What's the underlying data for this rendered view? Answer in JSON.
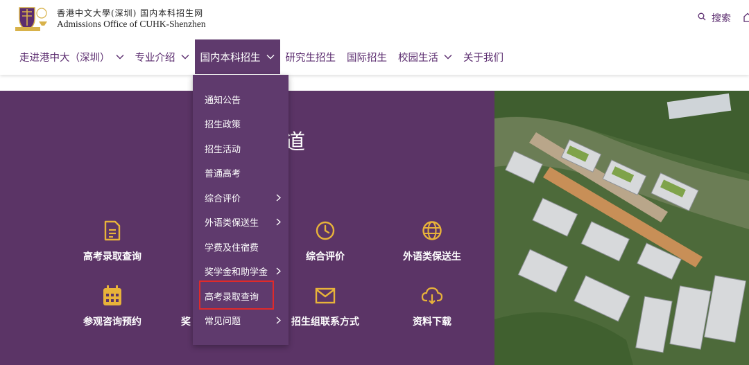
{
  "header": {
    "logo_cn": "香港中文大學(深圳) 国内本科招生网",
    "logo_en": "Admissions Office of CUHK-Shenzhen",
    "search_label": "搜索",
    "search_icon": "search-icon",
    "home_icon": "home-icon"
  },
  "nav": {
    "items": [
      {
        "label": "走进港中大（深圳）",
        "has_dropdown": true
      },
      {
        "label": "专业介绍",
        "has_dropdown": true
      },
      {
        "label": "国内本科招生",
        "has_dropdown": true,
        "active": true
      },
      {
        "label": "研究生招生",
        "has_dropdown": false
      },
      {
        "label": "国际招生",
        "has_dropdown": false
      },
      {
        "label": "校园生活",
        "has_dropdown": true
      },
      {
        "label": "关于我们",
        "has_dropdown": false
      }
    ]
  },
  "dropdown": {
    "items": [
      {
        "label": "通知公告",
        "has_submenu": false
      },
      {
        "label": "招生政策",
        "has_submenu": false
      },
      {
        "label": "招生活动",
        "has_submenu": false
      },
      {
        "label": "普通高考",
        "has_submenu": false
      },
      {
        "label": "综合评价",
        "has_submenu": true
      },
      {
        "label": "外语类保送生",
        "has_submenu": true
      },
      {
        "label": "学费及住宿费",
        "has_submenu": false
      },
      {
        "label": "奖学金和助学金",
        "has_submenu": true
      },
      {
        "label": "高考录取查询",
        "has_submenu": false,
        "highlighted": true
      },
      {
        "label": "常见问题",
        "has_submenu": true
      }
    ]
  },
  "hero": {
    "title_visible": "道",
    "quick_links": [
      {
        "label": "高考录取查询",
        "icon": "document-icon"
      },
      {
        "label": "综合评价",
        "icon": "clock-icon"
      },
      {
        "label": "外语类保送生",
        "icon": "globe-icon"
      },
      {
        "label": "参观咨询预约",
        "icon": "calendar-icon"
      },
      {
        "label": "奖",
        "icon": ""
      },
      {
        "label": "招生组联系方式",
        "icon": "mail-icon"
      },
      {
        "label": "资料下载",
        "icon": "cloud-download-icon"
      }
    ]
  },
  "colors": {
    "brand_purple": "#5b3466",
    "nav_text": "#5b2c6f",
    "icon_gold": "#e8b33a",
    "highlight_red": "#e02a2a"
  }
}
